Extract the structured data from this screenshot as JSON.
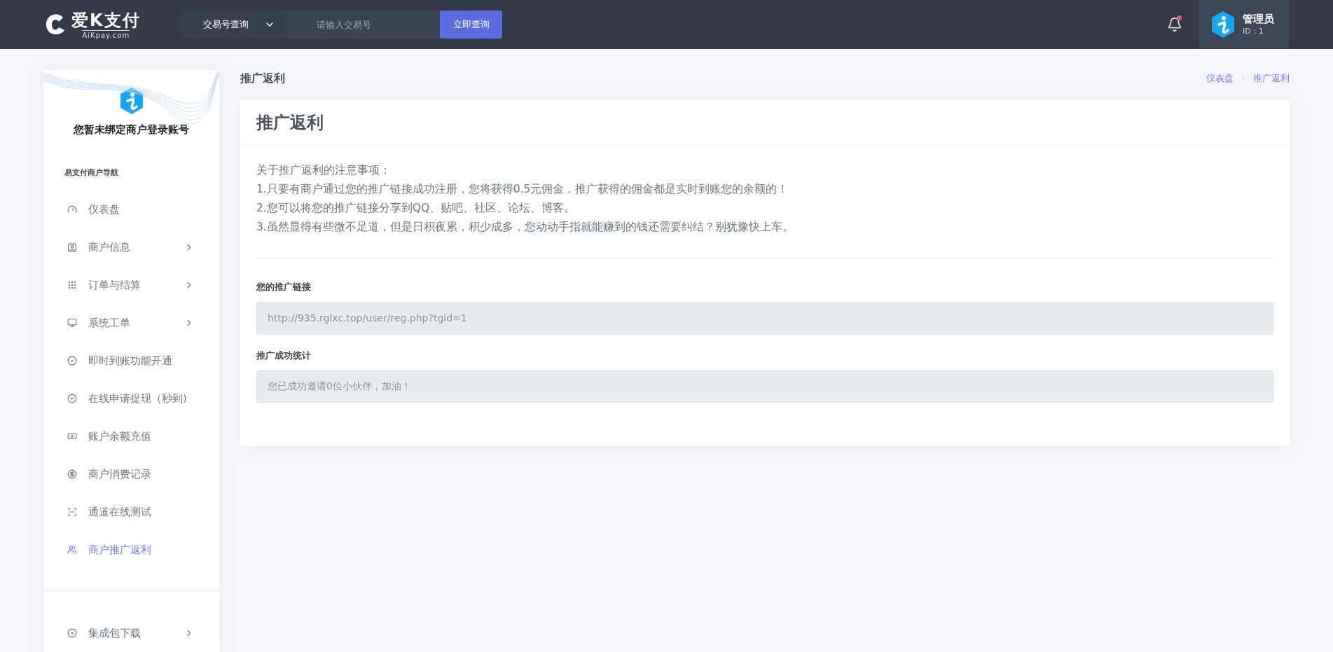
{
  "header": {
    "logo": {
      "name": "爱K支付",
      "domain": "AiKpay.com"
    },
    "search": {
      "type_select": "交易号查询",
      "placeholder": "请输入交易号",
      "button": "立即查询"
    },
    "notifications": {
      "unread": true
    },
    "user": {
      "name": "管理员",
      "id_line": "ID：1"
    }
  },
  "sidebar": {
    "account_notice": "您暂未绑定商户登录账号",
    "nav_title": "易支付商户导航",
    "items": [
      {
        "label": "仪表盘",
        "kind": "gauge",
        "submenu": false,
        "selected": false
      },
      {
        "label": "商户信息",
        "kind": "contact",
        "submenu": true,
        "selected": false
      },
      {
        "label": "订单与结算",
        "kind": "grid",
        "submenu": true,
        "selected": false
      },
      {
        "label": "系统工单",
        "kind": "monitor",
        "submenu": true,
        "selected": false
      },
      {
        "label": "即时到账功能开通",
        "kind": "check",
        "submenu": false,
        "selected": false
      },
      {
        "label": "在线申请提现（秒到)",
        "kind": "check",
        "submenu": false,
        "selected": false
      },
      {
        "label": "账户余额充值",
        "kind": "cash",
        "submenu": false,
        "selected": false
      },
      {
        "label": "商户消费记录",
        "kind": "dollar",
        "submenu": false,
        "selected": false
      },
      {
        "label": "通道在线测试",
        "kind": "test",
        "submenu": false,
        "selected": false
      },
      {
        "label": "商户推广返利",
        "kind": "users",
        "submenu": false,
        "selected": true
      }
    ],
    "bottom_items": [
      {
        "label": "集成包下载",
        "kind": "disc",
        "submenu": true,
        "selected": false
      }
    ]
  },
  "page": {
    "title": "推广返利",
    "breadcrumbs": [
      "仪表盘",
      "推广返利"
    ]
  },
  "card": {
    "title": "推广返利",
    "notes": [
      "关于推广返利的注意事项：",
      "1.只要有商户通过您的推广链接成功注册，您将获得0.5元佣金，推广获得的佣金都是实时到账您的余额的！",
      "2.您可以将您的推广链接分享到QQ、贴吧、社区、论坛、博客。",
      "3.虽然显得有些微不足道，但是日积夜累，积少成多，您动动手指就能赚到的钱还需要纠结？别犹豫快上车。"
    ],
    "fields": [
      {
        "label": "您的推广链接",
        "value": "http://935.rglxc.top/user/reg.php?tgid=1"
      },
      {
        "label": "推广成功统计",
        "value": "您已成功邀请0位小伙伴，加油！"
      }
    ]
  }
}
